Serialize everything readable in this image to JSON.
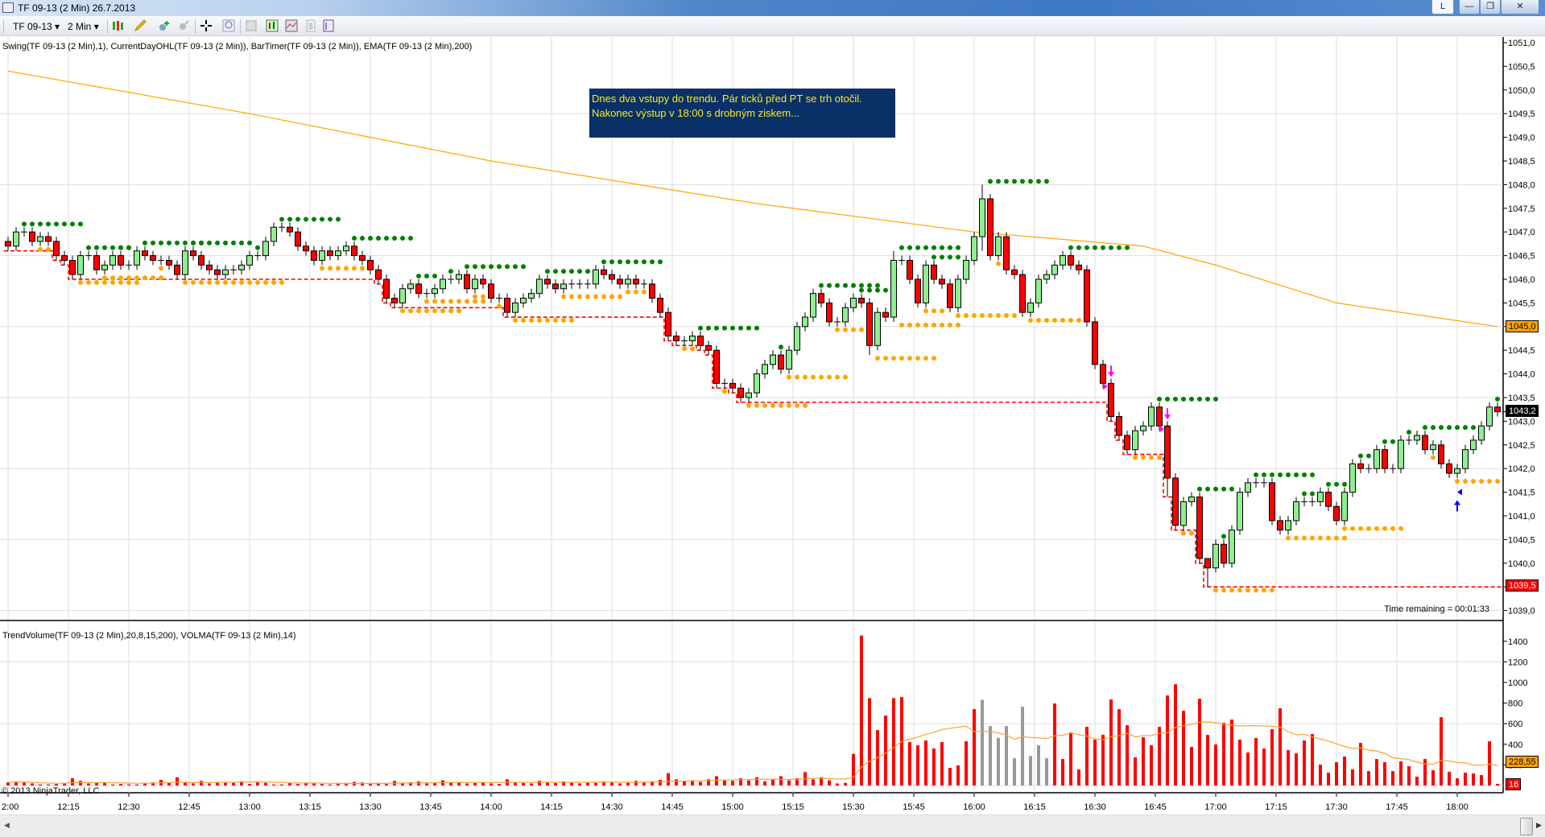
{
  "window": {
    "title": "TF 09-13 (2 Min)  26.7.2013",
    "buttons": {
      "l": "L",
      "minimize": "—",
      "restore": "❐",
      "close": "✕"
    }
  },
  "toolbar": {
    "instrument": "TF 09-13",
    "interval": "2 Min",
    "dropdown_arrow": "▾"
  },
  "price_panel": {
    "indicators_label": "Swing(TF 09-13 (2 Min),1), CurrentDayOHL(TF 09-13 (2 Min)), BarTimer(TF 09-13 (2 Min)), EMA(TF 09-13 (2 Min),200)",
    "note_line1": "Dnes dva vstupy do trendu. Pár ticků před PT se trh otočil.",
    "note_line2": "Nakonec výstup v 18:00 s drobným ziskem...",
    "time_remaining": "Time remaining = 00:01:33",
    "tags": {
      "ema": "1045,0",
      "last": "1043,2",
      "day_low": "1039,5"
    },
    "colors": {
      "up": "#90ee90",
      "down": "#ff0000",
      "ema": "#ffa500",
      "swing_high": "#008000",
      "swing_low": "#ffa500",
      "day_low": "#ff0000",
      "entry_arrow": "#ff00ff",
      "exit_arrow": "#0000ff"
    }
  },
  "volume_panel": {
    "indicators_label": "TrendVolume(TF 09-13 (2 Min),20,8,15,200), VOLMA(TF 09-13 (2 Min),14)",
    "copyright": "© 2013 NinjaTrader, LLC",
    "tags": {
      "volma": "228,55",
      "last_volume": "16"
    }
  },
  "chart_data": [
    {
      "type": "candlestick",
      "title": "TF 09-13 (2 Min)",
      "ylabel": "",
      "ylim": [
        1039.0,
        1051.0
      ],
      "y_ticks": [
        "1051,0",
        "1050,5",
        "1050,0",
        "1049,5",
        "1049,0",
        "1048,5",
        "1048,0",
        "1047,5",
        "1047,0",
        "1046,5",
        "1046,0",
        "1045,5",
        "1045,0",
        "1044,5",
        "1044,0",
        "1043,5",
        "1043,0",
        "1042,5",
        "1042,0",
        "1041,5",
        "1041,0",
        "1040,5",
        "1040,0",
        "1039,5",
        "1039,0"
      ],
      "x_ticks": [
        "2:00",
        "12:15",
        "12:30",
        "12:45",
        "13:00",
        "13:15",
        "13:30",
        "13:45",
        "14:00",
        "14:15",
        "14:30",
        "14:45",
        "15:00",
        "15:15",
        "15:30",
        "15:45",
        "16:00",
        "16:15",
        "16:30",
        "16:45",
        "17:00",
        "17:15",
        "17:30",
        "17:45",
        "18:00"
      ],
      "bar_interval_min": 2,
      "first_bar": "12:00",
      "close": [
        1046.7,
        1047.0,
        1047.0,
        1046.8,
        1046.9,
        1046.8,
        1046.5,
        1046.4,
        1046.1,
        1046.5,
        1046.5,
        1046.2,
        1046.3,
        1046.5,
        1046.3,
        1046.3,
        1046.6,
        1046.5,
        1046.4,
        1046.4,
        1046.3,
        1046.1,
        1046.6,
        1046.5,
        1046.3,
        1046.2,
        1046.1,
        1046.2,
        1046.2,
        1046.3,
        1046.5,
        1046.5,
        1046.8,
        1047.1,
        1047.1,
        1047.0,
        1046.7,
        1046.6,
        1046.4,
        1046.6,
        1046.5,
        1046.6,
        1046.7,
        1046.5,
        1046.4,
        1046.2,
        1046.0,
        1045.6,
        1045.5,
        1045.8,
        1045.9,
        1045.7,
        1045.7,
        1045.8,
        1046.0,
        1046.0,
        1046.1,
        1045.8,
        1046.0,
        1045.9,
        1045.6,
        1045.6,
        1045.3,
        1045.5,
        1045.6,
        1045.7,
        1046.0,
        1045.9,
        1045.8,
        1045.9,
        1045.9,
        1045.9,
        1045.9,
        1046.2,
        1046.1,
        1046.0,
        1045.9,
        1046.0,
        1045.9,
        1045.9,
        1045.6,
        1045.3,
        1044.8,
        1044.7,
        1044.7,
        1044.8,
        1044.6,
        1044.5,
        1043.8,
        1043.8,
        1043.7,
        1043.5,
        1043.6,
        1044.0,
        1044.2,
        1044.4,
        1044.1,
        1044.5,
        1045.0,
        1045.2,
        1045.7,
        1045.5,
        1045.1,
        1045.1,
        1045.4,
        1045.6,
        1045.5,
        1044.6,
        1045.3,
        1045.2,
        1046.4,
        1046.4,
        1046.0,
        1045.5,
        1046.3,
        1046.0,
        1045.9,
        1045.4,
        1046.0,
        1046.4,
        1046.9,
        1047.7,
        1046.5,
        1046.9,
        1046.2,
        1046.1,
        1045.3,
        1045.5,
        1046.0,
        1046.1,
        1046.3,
        1046.5,
        1046.3,
        1046.2,
        1045.1,
        1044.2,
        1043.8,
        1043.1,
        1042.7,
        1042.4,
        1042.8,
        1042.9,
        1043.3,
        1042.9,
        1041.8,
        1040.8,
        1041.3,
        1041.4,
        1040.1,
        1039.9,
        1040.4,
        1040.0,
        1040.7,
        1041.5,
        1041.7,
        1041.7,
        1041.7,
        1040.9,
        1040.7,
        1040.9,
        1041.3,
        1041.3,
        1041.3,
        1041.5,
        1041.2,
        1040.9,
        1041.5,
        1042.1,
        1042.0,
        1042.0,
        1042.4,
        1042.0,
        1042.0,
        1042.6,
        1042.6,
        1042.7,
        1042.4,
        1042.5,
        1042.1,
        1041.9,
        1042.0,
        1042.4,
        1042.6,
        1042.9,
        1043.3,
        1043.2
      ],
      "first_open": 1046.8,
      "wick_overrides": {
        "121": [
          1048.0,
          1046.6
        ],
        "149": [
          1040.1,
          1039.5
        ],
        "107": [
          1045.6,
          1044.4
        ],
        "110": [
          1046.6,
          1045.1
        ],
        "144": [
          1043.0,
          1041.4
        ]
      },
      "ema200": [
        [
          0,
          1050.4
        ],
        [
          30,
          1049.5
        ],
        [
          60,
          1048.5
        ],
        [
          93,
          1047.6
        ],
        [
          120,
          1047.0
        ],
        [
          141,
          1046.7
        ],
        [
          150,
          1046.3
        ],
        [
          165,
          1045.5
        ],
        [
          185,
          1045.0
        ]
      ],
      "markers": [
        {
          "bar": 137,
          "type": "short-entry",
          "price": 1043.7
        },
        {
          "bar": 144,
          "type": "short-entry",
          "price": 1042.8
        },
        {
          "bar": 180,
          "type": "exit",
          "price": 1041.4
        }
      ]
    },
    {
      "type": "bar",
      "title": "TrendVolume",
      "ylim": [
        0,
        1500
      ],
      "y_ticks": [
        "1400",
        "1200",
        "1000",
        "800",
        "600",
        "400",
        "200"
      ],
      "gray_bars": [
        121,
        122,
        123,
        124,
        125,
        126,
        127,
        128,
        129
      ],
      "volma_period": 14,
      "values": [
        30,
        40,
        30,
        20,
        10,
        10,
        15,
        20,
        70,
        45,
        20,
        25,
        30,
        10,
        15,
        10,
        10,
        20,
        30,
        55,
        25,
        80,
        35,
        20,
        45,
        20,
        35,
        30,
        25,
        40,
        15,
        30,
        25,
        10,
        10,
        25,
        15,
        20,
        25,
        15,
        10,
        20,
        25,
        35,
        30,
        20,
        25,
        15,
        45,
        25,
        30,
        40,
        20,
        25,
        50,
        30,
        35,
        20,
        25,
        30,
        20,
        15,
        60,
        30,
        25,
        20,
        45,
        30,
        25,
        40,
        35,
        20,
        30,
        25,
        40,
        35,
        20,
        30,
        45,
        30,
        40,
        55,
        120,
        60,
        40,
        50,
        35,
        60,
        90,
        55,
        45,
        70,
        50,
        80,
        40,
        60,
        90,
        50,
        70,
        130,
        60,
        80,
        50,
        20,
        25,
        307,
        1456,
        848,
        538,
        679,
        848,
        858,
        421,
        390,
        437,
        359,
        421,
        172,
        195,
        429,
        741,
        832,
        577,
        463,
        577,
        265,
        764,
        286,
        390,
        265,
        796,
        257,
        515,
        156,
        569,
        445,
        491,
        835,
        741,
        585,
        273,
        468,
        390,
        569,
        874,
        983,
        725,
        374,
        842,
        491,
        398,
        608,
        640,
        445,
        320,
        460,
        359,
        546,
        749,
        343,
        312,
        437,
        499,
        203,
        125,
        226,
        281,
        156,
        413,
        140,
        257,
        226,
        140,
        234,
        187,
        86,
        257,
        148,
        663,
        133,
        70,
        125,
        117,
        101,
        429,
        16
      ]
    }
  ]
}
